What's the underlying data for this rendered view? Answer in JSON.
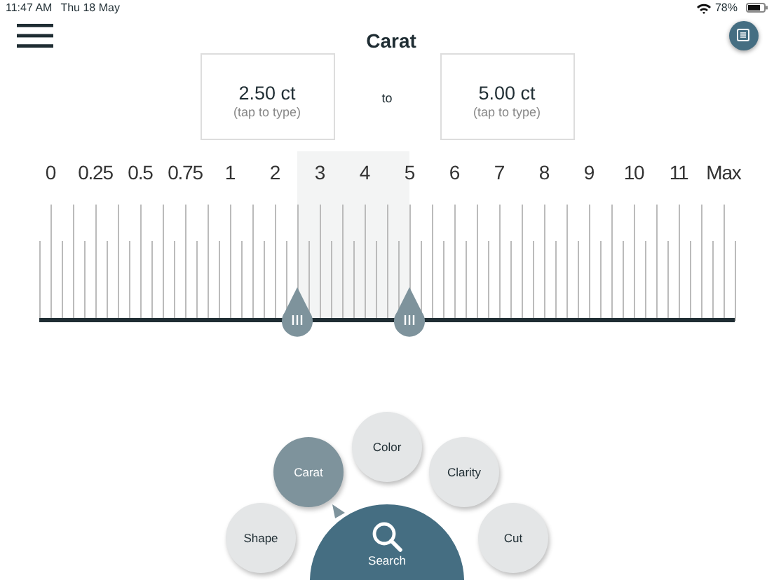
{
  "status_bar": {
    "time": "11:47 AM",
    "date": "Thu 18 May",
    "battery": "78%"
  },
  "header": {
    "title": "Carat"
  },
  "range": {
    "from": {
      "value": "2.50 ct",
      "hint": "(tap to type)"
    },
    "separator": "to",
    "to": {
      "value": "5.00 ct",
      "hint": "(tap to type)"
    }
  },
  "ruler": {
    "labels": [
      "0",
      "0.25",
      "0.5",
      "0.75",
      "1",
      "2",
      "3",
      "4",
      "5",
      "6",
      "7",
      "8",
      "9",
      "10",
      "11",
      "Max"
    ],
    "thumbs": [
      {
        "level": 0.371
      },
      {
        "level": 0.532
      }
    ]
  },
  "filters": [
    {
      "label": "Shape",
      "selected": false
    },
    {
      "label": "Carat",
      "selected": true
    },
    {
      "label": "Color",
      "selected": false
    },
    {
      "label": "Clarity",
      "selected": false
    },
    {
      "label": "Cut",
      "selected": false
    }
  ],
  "search": {
    "label": "Search"
  }
}
